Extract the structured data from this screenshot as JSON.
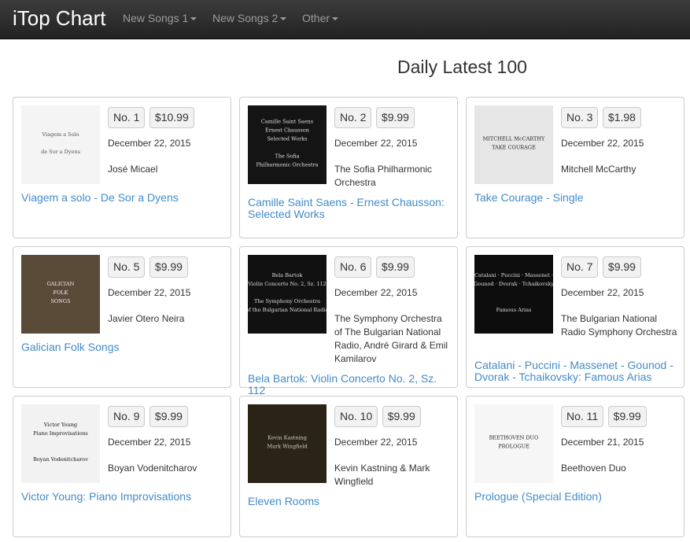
{
  "navbar": {
    "brand": "iTop Chart",
    "menus": [
      {
        "label": "New Songs 1"
      },
      {
        "label": "New Songs 2"
      },
      {
        "label": "Other"
      }
    ]
  },
  "page": {
    "title": "Daily Latest 100"
  },
  "albums": [
    {
      "rank": "No. 1",
      "price": "$10.99",
      "date": "December 22, 2015",
      "artist": "José Micael",
      "title": "Viagem a solo - De Sor a Dyens",
      "cover": {
        "bg": "#f4f4f4",
        "fg": "#555555",
        "lines": [
          "Viagem a Solo",
          "",
          "de Sor a Dyens"
        ]
      }
    },
    {
      "rank": "No. 2",
      "price": "$9.99",
      "date": "December 22, 2015",
      "artist": "The Sofia Philharmonic Orchestra",
      "title": "Camille Saint Saens - Ernest Chausson: Selected Works",
      "cover": {
        "bg": "#141414",
        "fg": "#e0e0e0",
        "lines": [
          "Camille Saint Saens",
          "Ernest Chausson",
          "Selected Works",
          "",
          "The Sofia",
          "Philharmonic Orchestra"
        ]
      }
    },
    {
      "rank": "No. 3",
      "price": "$1.98",
      "date": "December 22, 2015",
      "artist": "Mitchell McCarthy",
      "title": "Take Courage - Single",
      "cover": {
        "bg": "#e6e6e6",
        "fg": "#222222",
        "lines": [
          "MITCHELL McCARTHY",
          "TAKE COURAGE"
        ]
      }
    },
    {
      "rank": "No. 5",
      "price": "$9.99",
      "date": "December 22, 2015",
      "artist": "Javier Otero Neira",
      "title": "Galician Folk Songs",
      "cover": {
        "bg": "#5a4a38",
        "fg": "#f0f0f0",
        "lines": [
          "GALICIAN",
          "FOLK",
          "SONGS"
        ]
      }
    },
    {
      "rank": "No. 6",
      "price": "$9.99",
      "date": "December 22, 2015",
      "artist": "The Symphony Orchestra of The Bulgarian National Radio, André Girard & Emil Kamilarov",
      "title": "Bela Bartok: Violin Concerto No. 2, Sz. 112",
      "cover": {
        "bg": "#111111",
        "fg": "#dddddd",
        "lines": [
          "Bela Bartok",
          "Violin Concerto No. 2, Sz. 112",
          "",
          "The Symphony Orchestra",
          "of the Bulgarian National Radio"
        ]
      }
    },
    {
      "rank": "No. 7",
      "price": "$9.99",
      "date": "December 22, 2015",
      "artist": "The Bulgarian National Radio Symphony Orchestra",
      "title": "Catalani - Puccini - Massenet - Gounod - Dvorak - Tchaikovsky: Famous Arias",
      "cover": {
        "bg": "#0d0d0d",
        "fg": "#dddddd",
        "lines": [
          "Catalani · Puccini · Massenet ·",
          "Gounod · Dvorak · Tchaikovsky",
          "",
          "",
          "Famous Arias"
        ]
      }
    },
    {
      "rank": "No. 9",
      "price": "$9.99",
      "date": "December 22, 2015",
      "artist": "Boyan Vodenitcharov",
      "title": "Victor Young: Piano Improvisations",
      "cover": {
        "bg": "#f2f2f2",
        "fg": "#111111",
        "lines": [
          "Victor Young",
          "Piano Improvisations",
          "",
          "",
          "Boyan Vodenitcharov"
        ]
      }
    },
    {
      "rank": "No. 10",
      "price": "$9.99",
      "date": "December 22, 2015",
      "artist": "Kevin Kastning & Mark Wingfield",
      "title": "Eleven Rooms",
      "cover": {
        "bg": "#2b2416",
        "fg": "#cccccc",
        "lines": [
          "Kevin Kastning",
          "Mark Wingfield"
        ]
      }
    },
    {
      "rank": "No. 11",
      "price": "$9.99",
      "date": "December 21, 2015",
      "artist": "Beethoven Duo",
      "title": "Prologue (Special Edition)",
      "cover": {
        "bg": "#f6f6f6",
        "fg": "#222222",
        "lines": [
          "BEETHOVEN DUO",
          "PROLOGUE"
        ]
      }
    }
  ]
}
